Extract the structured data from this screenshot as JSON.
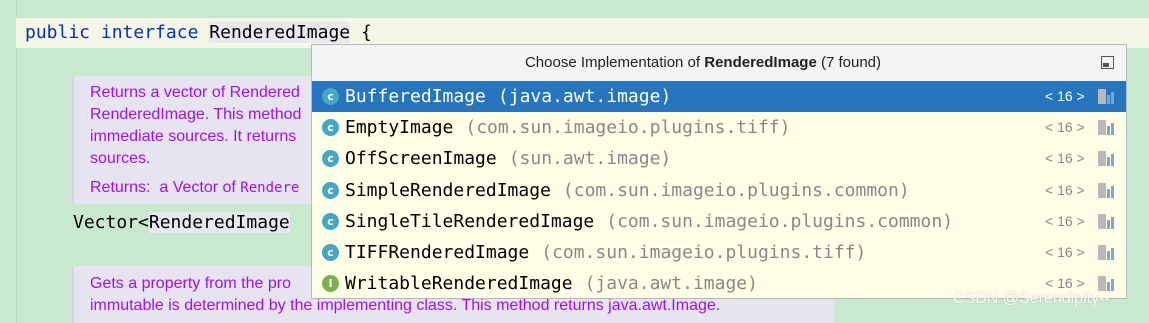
{
  "editor": {
    "line1": {
      "kw1": "public",
      "kw2": "interface",
      "name": "RenderedImage",
      "brace": "{"
    },
    "doc1": {
      "line1": "Returns a vector of Rendered",
      "line2": "RenderedImage. This method",
      "line3": "immediate sources. It returns",
      "line4": "sources.",
      "returns_label": "Returns:  a Vector of ",
      "returns_code": "Rendere"
    },
    "sig": {
      "prefix": "Vector<",
      "type": "RenderedImage"
    },
    "doc2": {
      "line1": "Gets a property from the pro",
      "line2": "immutable is determined by the implementing class. This method returns java.awt.Image."
    }
  },
  "popup": {
    "title_prefix": "Choose Implementation of ",
    "title_name": "RenderedImage",
    "title_suffix": " (7 found)",
    "items": [
      {
        "name": "BufferedImage",
        "pkg": "(java.awt.image)",
        "version": "< 16 >",
        "kind": "class",
        "icon": "class-icon",
        "selected": true
      },
      {
        "name": "EmptyImage",
        "pkg": "(com.sun.imageio.plugins.tiff)",
        "version": "< 16 >",
        "kind": "class",
        "icon": "class-icon",
        "selected": false
      },
      {
        "name": "OffScreenImage",
        "pkg": "(sun.awt.image)",
        "version": "< 16 >",
        "kind": "class",
        "icon": "class-icon",
        "selected": false
      },
      {
        "name": "SimpleRenderedImage",
        "pkg": "(com.sun.imageio.plugins.common)",
        "version": "< 16 >",
        "kind": "class",
        "icon": "class-icon",
        "selected": false
      },
      {
        "name": "SingleTileRenderedImage",
        "pkg": "(com.sun.imageio.plugins.common)",
        "version": "< 16 >",
        "kind": "class",
        "icon": "class-icon",
        "selected": false
      },
      {
        "name": "TIFFRenderedImage",
        "pkg": "(com.sun.imageio.plugins.tiff)",
        "version": "< 16 >",
        "kind": "class",
        "icon": "class-icon",
        "selected": false
      },
      {
        "name": "WritableRenderedImage",
        "pkg": "(java.awt.image)",
        "version": "< 16 >",
        "kind": "interface",
        "icon": "interface-icon",
        "selected": false
      }
    ]
  },
  "watermark": "CSDN @Serendipity--",
  "colors": {
    "selection": "#2675bf",
    "doc_text": "#a30ff2",
    "keyword": "#0033b3",
    "background": "#c8e9cf"
  }
}
